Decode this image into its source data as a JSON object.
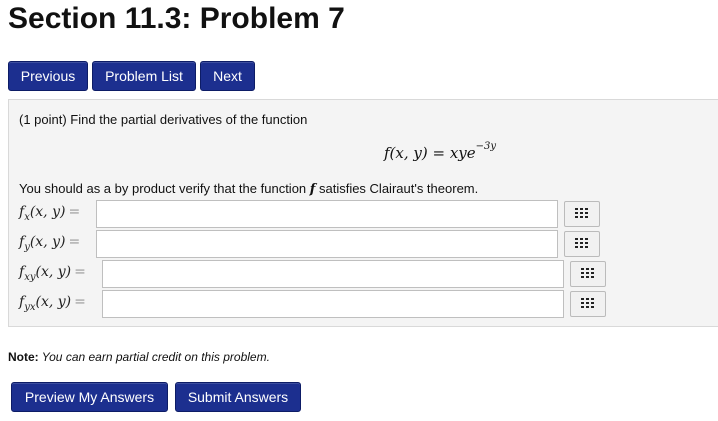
{
  "header": {
    "title": "Section 11.3: Problem 7"
  },
  "nav": {
    "previous": "Previous",
    "problem_list": "Problem List",
    "next": "Next"
  },
  "problem": {
    "intro": "(1 point) Find the partial derivatives of the function",
    "function_lhs": "f(x, y) = xye",
    "function_exp": "−3y",
    "verify_pre": "You should as a by product verify that the function ",
    "verify_f": "f",
    "verify_post": " satisfies Clairaut's theorem.",
    "answers": [
      {
        "label_main": "f",
        "label_sub": "x",
        "label_args": "(x, y)",
        "value": ""
      },
      {
        "label_main": "f",
        "label_sub": "y",
        "label_args": "(x, y)",
        "value": ""
      },
      {
        "label_main": "f",
        "label_sub": "xy",
        "label_args": "(x, y)",
        "value": ""
      },
      {
        "label_main": "f",
        "label_sub": "yx",
        "label_args": "(x, y)",
        "value": ""
      }
    ],
    "equals": "="
  },
  "note": {
    "label": "Note:",
    "text": " You can earn partial credit on this problem."
  },
  "actions": {
    "preview": "Preview My Answers",
    "submit": "Submit Answers"
  },
  "colors": {
    "button_bg": "#1c2f8f",
    "panel_bg": "#f4f4f4"
  }
}
